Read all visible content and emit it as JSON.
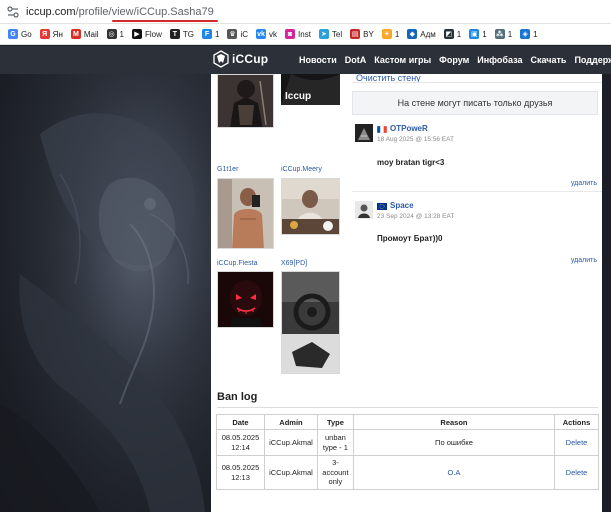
{
  "browser": {
    "url_host": "iccup.com",
    "url_path": "/profile/view/iCCup.Sasha79"
  },
  "bookmarks": [
    {
      "label": "Go",
      "icon": "google-icon",
      "color": "#4285f4",
      "glyph": "G"
    },
    {
      "label": "Ян",
      "icon": "yandex-icon",
      "color": "#e53935",
      "glyph": "Я"
    },
    {
      "label": "Mail",
      "icon": "mail-icon",
      "color": "#d93025",
      "glyph": "M"
    },
    {
      "label": "1",
      "icon": "chatgpt-icon",
      "color": "#333333",
      "glyph": "◎"
    },
    {
      "label": "Flow",
      "icon": "flow-icon",
      "color": "#111111",
      "glyph": "▶"
    },
    {
      "label": "TG",
      "icon": "tg-icon",
      "color": "#222222",
      "glyph": "T"
    },
    {
      "label": "1",
      "icon": "bookmark-1-icon",
      "color": "#1e88e5",
      "glyph": "F"
    },
    {
      "label": "iC",
      "icon": "iccup-icon",
      "color": "#555555",
      "glyph": "♛"
    },
    {
      "label": "vk",
      "icon": "vk-icon",
      "color": "#2787f5",
      "glyph": "vk"
    },
    {
      "label": "Inst",
      "icon": "instagram-icon",
      "color": "#d6249f",
      "glyph": "◙"
    },
    {
      "label": "Tel",
      "icon": "telegram-icon",
      "color": "#2aa1da",
      "glyph": "➤"
    },
    {
      "label": "BY",
      "icon": "by-icon",
      "color": "#c62828",
      "glyph": "▤"
    },
    {
      "label": "1",
      "icon": "sun-icon",
      "color": "#f9a825",
      "glyph": "☀"
    },
    {
      "label": "Адм",
      "icon": "admin-icon",
      "color": "#1565c0",
      "glyph": "◆"
    },
    {
      "label": "1",
      "icon": "bookmark-2-icon",
      "color": "#263238",
      "glyph": "◩"
    },
    {
      "label": "1",
      "icon": "bookmark-3-icon",
      "color": "#1e88e5",
      "glyph": "▣"
    },
    {
      "label": "1",
      "icon": "bookmark-4-icon",
      "color": "#546e7a",
      "glyph": "⁂"
    },
    {
      "label": "1",
      "icon": "bookmark-5-icon",
      "color": "#1976d2",
      "glyph": "◈"
    }
  ],
  "site": {
    "logo": "iCCup",
    "nav": [
      "Новости",
      "DotA",
      "Кастом игры",
      "Форум",
      "Инфобаза",
      "Скачать",
      "Поддержка"
    ]
  },
  "friends": [
    {
      "name": "",
      "photo": "warrior"
    },
    {
      "name": "",
      "photo": "iccup-logo",
      "overlay": "Iccup"
    },
    {
      "name": "G1t1er",
      "photo": "mirror-selfie"
    },
    {
      "name": "iCCup.Meery",
      "photo": "child-table"
    },
    {
      "name": "iCCup.Fiesta",
      "photo": "neon-mask"
    },
    {
      "name": "X69[PD]",
      "photo": "car-interior"
    }
  ],
  "wall": {
    "clear_label": "Очистить стену",
    "notice": "На стене могут писать только друзья",
    "posts": [
      {
        "author": "OTPoweR",
        "flag": "france",
        "date": "18 Aug 2025 @ 15:56 EAT",
        "text": "moy bratan tigr<3",
        "delete": "удалить"
      },
      {
        "author": "Space",
        "flag": "eu",
        "date": "23 Sep 2024 @ 13:28 EAT",
        "text": "Промоут Брат))0",
        "delete": "удалить"
      }
    ]
  },
  "banlog": {
    "title": "Ban log",
    "headers": [
      "Date",
      "Admin",
      "Type",
      "Reason",
      "Actions"
    ],
    "rows": [
      {
        "date": "08.05.2025 12:14",
        "admin": "iCCup.Akmal",
        "type": "unban type - 1",
        "reason": "По ошибке",
        "action": "Delete"
      },
      {
        "date": "08.05.2025 12:13",
        "admin": "iCCup.Akmal",
        "type": "3-account only",
        "reason": "O.A",
        "action": "Delete"
      }
    ]
  }
}
